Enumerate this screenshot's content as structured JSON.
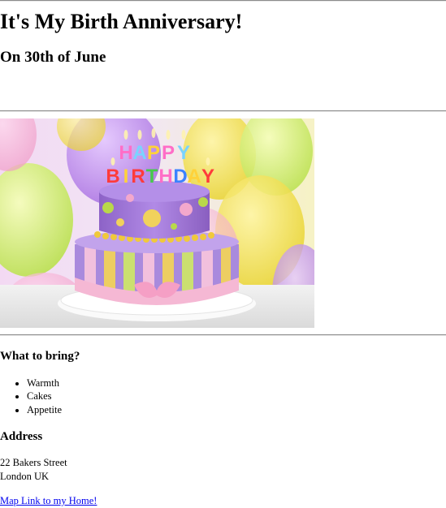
{
  "page": {
    "title": "It's My Birth Anniversary!",
    "date_line": "On 30th of June"
  },
  "hero_image": {
    "alt": "Birthday cake",
    "candle_text": "HAPPY BIRTHDAY"
  },
  "bring": {
    "heading": "What to bring?",
    "items": [
      "Warmth",
      "Cakes",
      "Appetite"
    ]
  },
  "address": {
    "heading": "Address",
    "line1": "22 Bakers Street",
    "line2": "London UK"
  },
  "map_link": {
    "label": "Map Link to my Home!"
  }
}
